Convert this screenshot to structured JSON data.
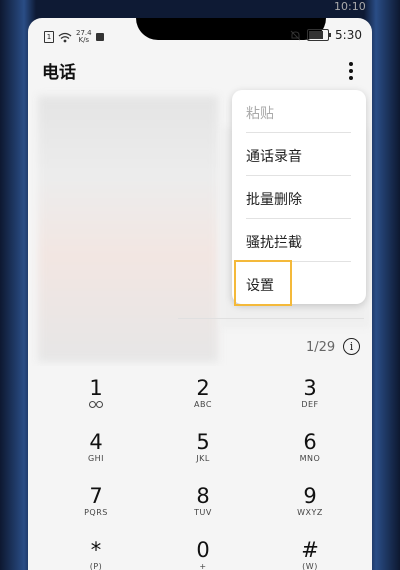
{
  "status_bar": {
    "top_time": "10:10",
    "speed_value": "27.4",
    "speed_unit": "K/s",
    "battery_level": "100",
    "time": "5:30"
  },
  "app": {
    "title": "电话"
  },
  "menu": {
    "items": [
      {
        "label": "粘贴",
        "enabled": false
      },
      {
        "label": "通话录音",
        "enabled": true
      },
      {
        "label": "批量删除",
        "enabled": true
      },
      {
        "label": "骚扰拦截",
        "enabled": true
      },
      {
        "label": "设置",
        "enabled": true,
        "highlighted": true
      }
    ]
  },
  "page_indicator": "1/29",
  "info_label": "i",
  "dial_pad": {
    "keys": [
      {
        "digit": "1",
        "letters": ""
      },
      {
        "digit": "2",
        "letters": "ABC"
      },
      {
        "digit": "3",
        "letters": "DEF"
      },
      {
        "digit": "4",
        "letters": "GHI"
      },
      {
        "digit": "5",
        "letters": "JKL"
      },
      {
        "digit": "6",
        "letters": "MNO"
      },
      {
        "digit": "7",
        "letters": "PQRS"
      },
      {
        "digit": "8",
        "letters": "TUV"
      },
      {
        "digit": "9",
        "letters": "WXYZ"
      },
      {
        "digit": "*",
        "letters": "(P)"
      },
      {
        "digit": "0",
        "letters": "+"
      },
      {
        "digit": "#",
        "letters": "(W)"
      }
    ]
  },
  "colors": {
    "highlight": "#f4b93a",
    "frame": "#1b2a4a"
  },
  "icons": [
    "sim-icon",
    "wifi-icon",
    "media-icon",
    "mute-icon",
    "battery-icon",
    "more-icon",
    "info-icon",
    "voicemail-icon"
  ]
}
